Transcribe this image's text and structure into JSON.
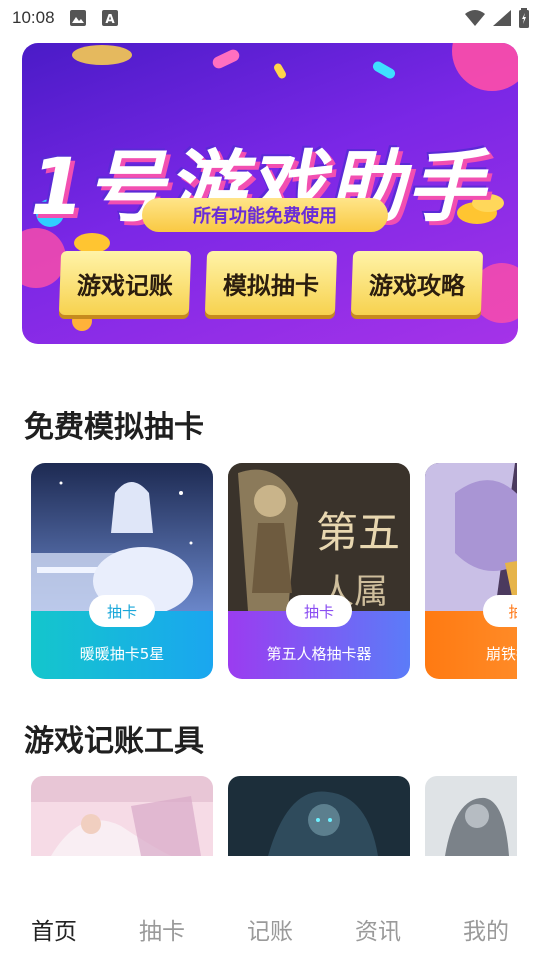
{
  "status_bar": {
    "time": "10:08",
    "icons": [
      "image-icon",
      "font-icon",
      "wifi-icon",
      "signal-icon",
      "battery-icon"
    ]
  },
  "banner": {
    "title": "1号游戏助手",
    "subtitle": "所有功能免费使用",
    "features": [
      "游戏记账",
      "模拟抽卡",
      "游戏攻略"
    ]
  },
  "sections": {
    "draw_cards": {
      "title": "免费模拟抽卡",
      "cards": [
        {
          "tag": "抽卡",
          "name": "暖暖抽卡5星",
          "color": "#16b8d6"
        },
        {
          "tag": "抽卡",
          "name": "第五人格抽卡器",
          "color": "#8a4df2"
        },
        {
          "tag": "抽",
          "name": "崩铁抽卡",
          "color": "#ff7a1a"
        }
      ]
    },
    "accounting": {
      "title": "游戏记账工具"
    }
  },
  "bottom_nav": {
    "items": [
      "首页",
      "抽卡",
      "记账",
      "资讯",
      "我的"
    ],
    "active": "首页"
  },
  "colors": {
    "cyan_tag_text": "#1aa7d9",
    "purple_tag_text": "#8a4df2",
    "orange_tag_text": "#ff7a1a"
  }
}
